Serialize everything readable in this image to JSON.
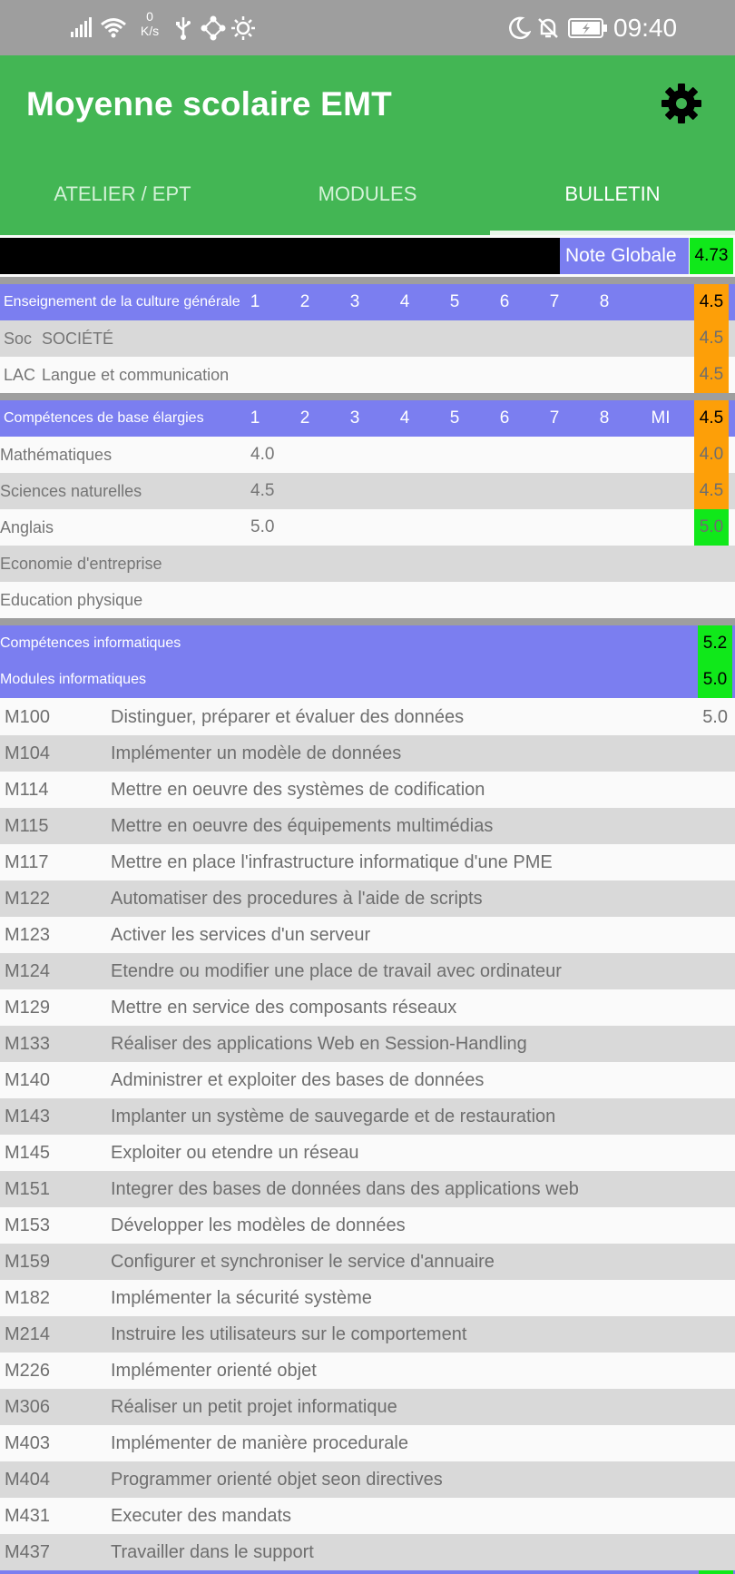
{
  "status_bar": {
    "net_speed_value": "0",
    "net_speed_unit": "K/s",
    "time": "09:40",
    "left_icons": [
      "signal-icon",
      "wifi-icon",
      "usb-icon",
      "network-share-icon",
      "brightness-icon"
    ],
    "right_icons": [
      "moon-icon",
      "bell-off-icon",
      "battery-charging-icon"
    ]
  },
  "app_bar": {
    "title": "Moyenne scolaire EMT",
    "settings_icon": "gear-icon"
  },
  "tabs": [
    {
      "label": "ATELIER / EPT",
      "active": false
    },
    {
      "label": "MODULES",
      "active": false
    },
    {
      "label": "BULLETIN",
      "active": true
    }
  ],
  "note_globale": {
    "label": "Note Globale",
    "value": "4.73"
  },
  "culture_generale": {
    "title": "Enseignement de la culture générale",
    "columns": [
      "1",
      "2",
      "3",
      "4",
      "5",
      "6",
      "7",
      "8"
    ],
    "average": "4.5",
    "rows": [
      {
        "code": "Soc",
        "name": "SOCIÉTÉ",
        "average": "4.5"
      },
      {
        "code": "LAC",
        "name": "Langue et communication",
        "average": "4.5"
      }
    ]
  },
  "competences_base": {
    "title": "Compétences de base élargies",
    "columns": [
      "1",
      "2",
      "3",
      "4",
      "5",
      "6",
      "7",
      "8",
      "MI"
    ],
    "average": "4.5",
    "rows": [
      {
        "name": "Mathématiques",
        "grade": "4.0",
        "average": "4.0",
        "badge": "orange"
      },
      {
        "name": "Sciences naturelles",
        "grade": "4.5",
        "average": "4.5",
        "badge": "orange"
      },
      {
        "name": "Anglais",
        "grade": "5.0",
        "average": "5.0",
        "badge": "green"
      },
      {
        "name": "Economie d'entreprise",
        "grade": "",
        "average": "",
        "badge": ""
      },
      {
        "name": "Education physique",
        "grade": "",
        "average": "",
        "badge": ""
      }
    ]
  },
  "competences_informatiques": {
    "title": "Compétences informatiques",
    "average": "5.2"
  },
  "modules_informatiques": {
    "title": "Modules informatiques",
    "average": "5.0",
    "modules": [
      {
        "code": "M100",
        "name": "Distinguer, préparer et évaluer des données",
        "grade": "5.0"
      },
      {
        "code": "M104",
        "name": "Implémenter un modèle de données",
        "grade": ""
      },
      {
        "code": "M114",
        "name": "Mettre en oeuvre des systèmes de codification",
        "grade": ""
      },
      {
        "code": "M115",
        "name": "Mettre en oeuvre des équipements multimédias",
        "grade": ""
      },
      {
        "code": "M117",
        "name": "Mettre en place l'infrastructure informatique d'une PME",
        "grade": ""
      },
      {
        "code": "M122",
        "name": "Automatiser des procedures à l'aide de scripts",
        "grade": ""
      },
      {
        "code": "M123",
        "name": "Activer les services d'un serveur",
        "grade": ""
      },
      {
        "code": "M124",
        "name": "Etendre ou modifier une place de travail avec ordinateur",
        "grade": ""
      },
      {
        "code": "M129",
        "name": "Mettre en service des composants réseaux",
        "grade": ""
      },
      {
        "code": "M133",
        "name": "Réaliser des applications Web en Session-Handling",
        "grade": ""
      },
      {
        "code": "M140",
        "name": "Administrer et exploiter des bases de données",
        "grade": ""
      },
      {
        "code": "M143",
        "name": "Implanter un système de sauvegarde et de restauration",
        "grade": ""
      },
      {
        "code": "M145",
        "name": "Exploiter ou etendre un réseau",
        "grade": ""
      },
      {
        "code": "M151",
        "name": "Integrer des bases de données dans des applications web",
        "grade": ""
      },
      {
        "code": "M153",
        "name": "Développer les modèles de données",
        "grade": ""
      },
      {
        "code": "M159",
        "name": "Configurer et synchroniser le service d'annuaire",
        "grade": ""
      },
      {
        "code": "M182",
        "name": "Implémenter la sécurité système",
        "grade": ""
      },
      {
        "code": "M214",
        "name": "Instruire les utilisateurs sur le comportement",
        "grade": ""
      },
      {
        "code": "M226",
        "name": "Implémenter orienté objet",
        "grade": ""
      },
      {
        "code": "M306",
        "name": "Réaliser un petit projet informatique",
        "grade": ""
      },
      {
        "code": "M403",
        "name": "Implémenter de manière procedurale",
        "grade": ""
      },
      {
        "code": "M404",
        "name": "Programmer orienté objet seon directives",
        "grade": ""
      },
      {
        "code": "M431",
        "name": "Executer des mandats",
        "grade": ""
      },
      {
        "code": "M437",
        "name": "Travailler dans le support",
        "grade": ""
      }
    ]
  },
  "colors": {
    "app_green": "#43b654",
    "section_blue": "#7b7ef0",
    "badge_orange": "#fd9f08",
    "badge_green": "#10e81a",
    "divider_gray": "#9e9e9e",
    "row_gray": "#d9d9d9"
  }
}
